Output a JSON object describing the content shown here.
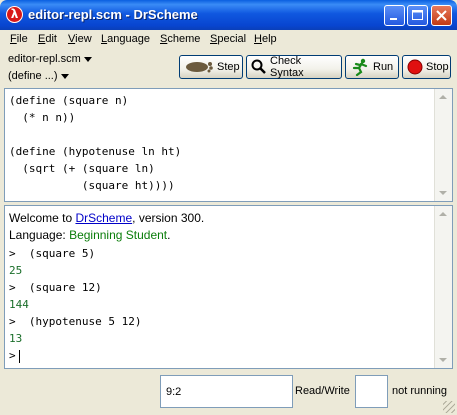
{
  "window": {
    "title": "editor-repl.scm - DrScheme"
  },
  "menu": [
    {
      "label": "File",
      "u": "F",
      "rest": "ile"
    },
    {
      "label": "Edit",
      "u": "E",
      "rest": "dit"
    },
    {
      "label": "View",
      "u": "V",
      "rest": "iew"
    },
    {
      "label": "Language",
      "u": "L",
      "rest": "anguage"
    },
    {
      "label": "Scheme",
      "u": "S",
      "rest": "cheme"
    },
    {
      "label": "Special",
      "u": "S",
      "rest": "pecial"
    },
    {
      "label": "Help",
      "u": "H",
      "rest": "elp"
    }
  ],
  "toolbar": {
    "file_name": "editor-repl.scm",
    "define_menu": "(define ...)",
    "step_label": "Step",
    "check_syntax_label": "Check Syntax",
    "run_label": "Run",
    "stop_label": "Stop"
  },
  "editor": {
    "code": "(define (square n)\n  (* n n))\n\n(define (hypotenuse ln ht)\n  (sqrt (+ (square ln)\n           (square ht))))"
  },
  "repl": {
    "welcome_prefix": "Welcome to ",
    "welcome_link": "DrScheme",
    "welcome_suffix": ", version 300.",
    "language_prefix": "Language: ",
    "language_name": "Beginning Student",
    "language_suffix": ".",
    "interactions": [
      {
        "prompt": ">",
        "input": "(square 5)",
        "output": "25"
      },
      {
        "prompt": ">",
        "input": "(square 12)",
        "output": "144"
      },
      {
        "prompt": ">",
        "input": "(hypotenuse 5 12)",
        "output": "13"
      }
    ],
    "final_prompt": ">"
  },
  "status": {
    "position": "9:2",
    "mode": "Read/Write",
    "state": "not running"
  },
  "colors": {
    "titlebar": "#0a5fe0",
    "link": "#0000c8",
    "language": "#0a7d0a",
    "result": "#1a6e2a"
  }
}
